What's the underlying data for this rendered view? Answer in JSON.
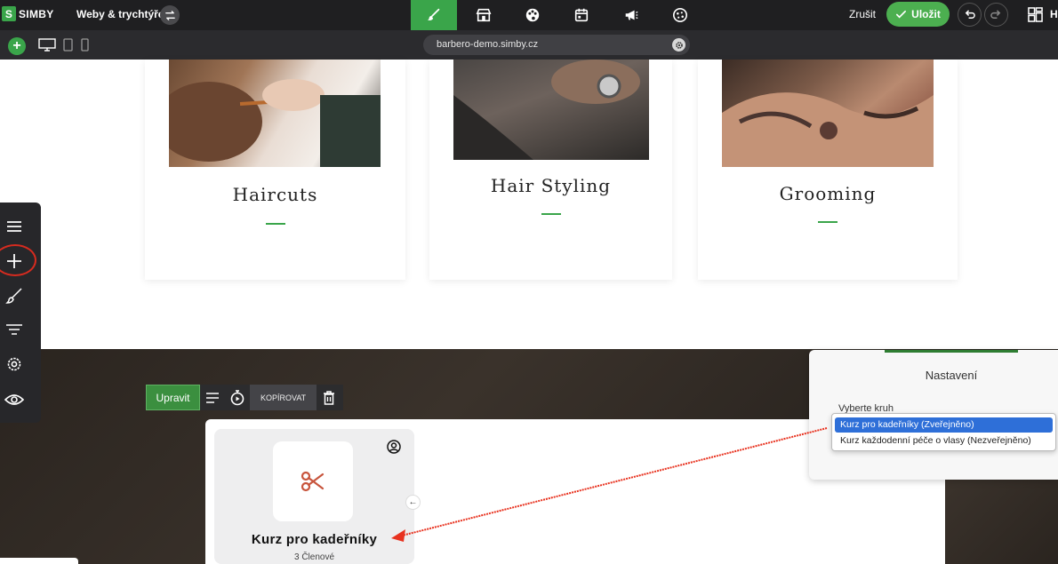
{
  "topbar": {
    "logo_text": "SIMBY",
    "logo_letter": "S",
    "site_name": "Weby & trychtýře",
    "tools": [
      "brush-icon",
      "store-icon",
      "palette-icon",
      "calendar-icon",
      "megaphone-icon",
      "cookie-icon"
    ],
    "active_tool": "brush-icon",
    "cancel_label": "Zrušit",
    "save_label": "Uložit",
    "cut_label": "H",
    "accent": "#3aa54a"
  },
  "subbar": {
    "url": "barbero-demo.simby.cz"
  },
  "services": [
    {
      "title": "Haircuts"
    },
    {
      "title": "Hair Styling"
    },
    {
      "title": "Grooming"
    }
  ],
  "block_toolbar": {
    "edit_label": "Upravit",
    "copy_label": "KOPÍROVAT"
  },
  "course": {
    "title": "Kurz pro kadeřníky",
    "members": "3 Členové"
  },
  "settings": {
    "title": "Nastavení",
    "select_label": "Vyberte kruh",
    "options": [
      "Kurz pro kadeřníky (Zveřejněno)",
      "Kurz každodenní péče o vlasy (Nezveřejněno)"
    ],
    "selected_index": 0
  }
}
